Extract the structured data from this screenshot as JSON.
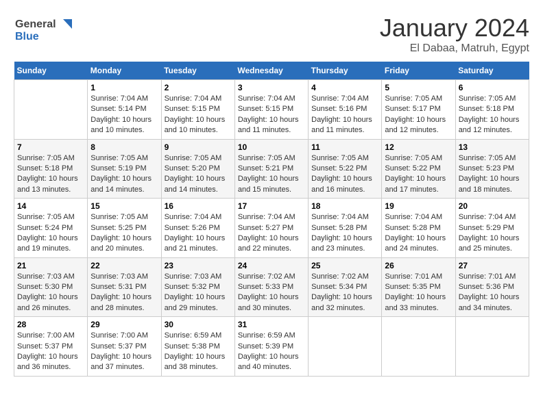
{
  "logo": {
    "general": "General",
    "blue": "Blue"
  },
  "header": {
    "month": "January 2024",
    "location": "El Dabaa, Matruh, Egypt"
  },
  "weekdays": [
    "Sunday",
    "Monday",
    "Tuesday",
    "Wednesday",
    "Thursday",
    "Friday",
    "Saturday"
  ],
  "weeks": [
    [
      {
        "day": "",
        "info": ""
      },
      {
        "day": "1",
        "sunrise": "7:04 AM",
        "sunset": "5:14 PM",
        "daylight": "10 hours and 10 minutes."
      },
      {
        "day": "2",
        "sunrise": "7:04 AM",
        "sunset": "5:15 PM",
        "daylight": "10 hours and 10 minutes."
      },
      {
        "day": "3",
        "sunrise": "7:04 AM",
        "sunset": "5:15 PM",
        "daylight": "10 hours and 11 minutes."
      },
      {
        "day": "4",
        "sunrise": "7:04 AM",
        "sunset": "5:16 PM",
        "daylight": "10 hours and 11 minutes."
      },
      {
        "day": "5",
        "sunrise": "7:05 AM",
        "sunset": "5:17 PM",
        "daylight": "10 hours and 12 minutes."
      },
      {
        "day": "6",
        "sunrise": "7:05 AM",
        "sunset": "5:18 PM",
        "daylight": "10 hours and 12 minutes."
      }
    ],
    [
      {
        "day": "7",
        "sunrise": "7:05 AM",
        "sunset": "5:18 PM",
        "daylight": "10 hours and 13 minutes."
      },
      {
        "day": "8",
        "sunrise": "7:05 AM",
        "sunset": "5:19 PM",
        "daylight": "10 hours and 14 minutes."
      },
      {
        "day": "9",
        "sunrise": "7:05 AM",
        "sunset": "5:20 PM",
        "daylight": "10 hours and 14 minutes."
      },
      {
        "day": "10",
        "sunrise": "7:05 AM",
        "sunset": "5:21 PM",
        "daylight": "10 hours and 15 minutes."
      },
      {
        "day": "11",
        "sunrise": "7:05 AM",
        "sunset": "5:22 PM",
        "daylight": "10 hours and 16 minutes."
      },
      {
        "day": "12",
        "sunrise": "7:05 AM",
        "sunset": "5:22 PM",
        "daylight": "10 hours and 17 minutes."
      },
      {
        "day": "13",
        "sunrise": "7:05 AM",
        "sunset": "5:23 PM",
        "daylight": "10 hours and 18 minutes."
      }
    ],
    [
      {
        "day": "14",
        "sunrise": "7:05 AM",
        "sunset": "5:24 PM",
        "daylight": "10 hours and 19 minutes."
      },
      {
        "day": "15",
        "sunrise": "7:05 AM",
        "sunset": "5:25 PM",
        "daylight": "10 hours and 20 minutes."
      },
      {
        "day": "16",
        "sunrise": "7:04 AM",
        "sunset": "5:26 PM",
        "daylight": "10 hours and 21 minutes."
      },
      {
        "day": "17",
        "sunrise": "7:04 AM",
        "sunset": "5:27 PM",
        "daylight": "10 hours and 22 minutes."
      },
      {
        "day": "18",
        "sunrise": "7:04 AM",
        "sunset": "5:28 PM",
        "daylight": "10 hours and 23 minutes."
      },
      {
        "day": "19",
        "sunrise": "7:04 AM",
        "sunset": "5:28 PM",
        "daylight": "10 hours and 24 minutes."
      },
      {
        "day": "20",
        "sunrise": "7:04 AM",
        "sunset": "5:29 PM",
        "daylight": "10 hours and 25 minutes."
      }
    ],
    [
      {
        "day": "21",
        "sunrise": "7:03 AM",
        "sunset": "5:30 PM",
        "daylight": "10 hours and 26 minutes."
      },
      {
        "day": "22",
        "sunrise": "7:03 AM",
        "sunset": "5:31 PM",
        "daylight": "10 hours and 28 minutes."
      },
      {
        "day": "23",
        "sunrise": "7:03 AM",
        "sunset": "5:32 PM",
        "daylight": "10 hours and 29 minutes."
      },
      {
        "day": "24",
        "sunrise": "7:02 AM",
        "sunset": "5:33 PM",
        "daylight": "10 hours and 30 minutes."
      },
      {
        "day": "25",
        "sunrise": "7:02 AM",
        "sunset": "5:34 PM",
        "daylight": "10 hours and 32 minutes."
      },
      {
        "day": "26",
        "sunrise": "7:01 AM",
        "sunset": "5:35 PM",
        "daylight": "10 hours and 33 minutes."
      },
      {
        "day": "27",
        "sunrise": "7:01 AM",
        "sunset": "5:36 PM",
        "daylight": "10 hours and 34 minutes."
      }
    ],
    [
      {
        "day": "28",
        "sunrise": "7:00 AM",
        "sunset": "5:37 PM",
        "daylight": "10 hours and 36 minutes."
      },
      {
        "day": "29",
        "sunrise": "7:00 AM",
        "sunset": "5:37 PM",
        "daylight": "10 hours and 37 minutes."
      },
      {
        "day": "30",
        "sunrise": "6:59 AM",
        "sunset": "5:38 PM",
        "daylight": "10 hours and 38 minutes."
      },
      {
        "day": "31",
        "sunrise": "6:59 AM",
        "sunset": "5:39 PM",
        "daylight": "10 hours and 40 minutes."
      },
      {
        "day": "",
        "info": ""
      },
      {
        "day": "",
        "info": ""
      },
      {
        "day": "",
        "info": ""
      }
    ]
  ],
  "labels": {
    "sunrise": "Sunrise:",
    "sunset": "Sunset:",
    "daylight": "Daylight:"
  }
}
